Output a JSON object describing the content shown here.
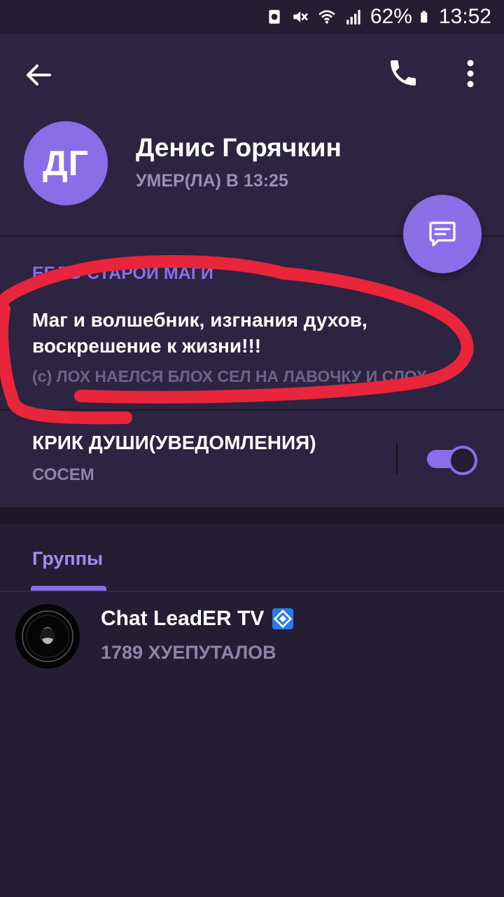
{
  "status_bar": {
    "battery": "62%",
    "time": "13:52",
    "icons": [
      "recycle-icon",
      "mute-icon",
      "wifi-icon",
      "signal-icon",
      "battery-icon"
    ]
  },
  "toolbar": {
    "back_icon": "back-arrow-icon",
    "call_icon": "phone-icon",
    "menu_icon": "more-vert-icon"
  },
  "profile": {
    "initials": "ДГ",
    "name": "Денис Горячкин",
    "last_seen": "УМЕР(ЛА) В  13:25",
    "fab_icon": "message-icon"
  },
  "bio": {
    "title": "ЕБЛО СТАРОЙ МАГИ",
    "text_line1": "Маг и волшебник, изгнания духов,",
    "text_line2": "воскрешение к жизни!!!",
    "subtitle": "(с) ЛОХ НАЕЛСЯ БЛОХ СЕЛ НА ЛАВОЧКУ И СЛОХ"
  },
  "notifications": {
    "title": "КРИК ДУШИ(УВЕДОМЛЕНИЯ)",
    "subtitle": "СОСЕМ",
    "enabled": true
  },
  "groups": {
    "tab_label": "Группы",
    "items": [
      {
        "name": "Chat LeadER TV",
        "subtitle": "1789 ХУЕПУТАЛОВ",
        "badge_icon": "verified-icon"
      }
    ]
  },
  "colors": {
    "background": "#241d33",
    "surface": "#2c2440",
    "accent": "#8a6ee8",
    "muted_text": "#8e84a8",
    "annotation": "#e8253a"
  }
}
